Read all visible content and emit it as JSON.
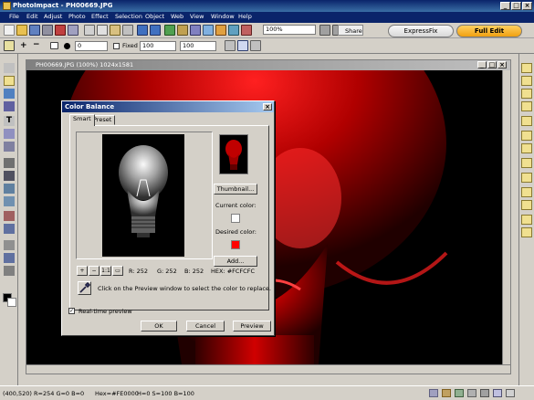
{
  "app": {
    "title": "PhotoImpact - PH00669.JPG",
    "min": "_",
    "max": "□",
    "close": "×"
  },
  "menu": [
    "File",
    "Edit",
    "Adjust",
    "Photo",
    "Effect",
    "Selection",
    "Object",
    "Web",
    "View",
    "Window",
    "Help"
  ],
  "toolbar": {
    "zoom_value": "100%",
    "share_label": "Share",
    "expressfix_label": "ExpressFix",
    "fulledit_label": "Full Edit"
  },
  "attrbar": {
    "angle_value": "0",
    "fixed_label": "Fixed",
    "width_value": "100",
    "height_value": "100"
  },
  "document": {
    "title": "PH00669.JPG (100%) 1024x1581",
    "min": "_",
    "max": "□",
    "close": "×"
  },
  "dialog": {
    "title": "Color Balance",
    "close": "×",
    "tabs": [
      {
        "label": "Smart",
        "active": true
      },
      {
        "label": "Preset",
        "active": false
      }
    ],
    "thumbnail_button": "Thumbnail...",
    "current_color_label": "Current color:",
    "current_color": "#FCFCFC",
    "desired_color_label": "Desired color:",
    "desired_color": "#FE0000",
    "add_button": "Add...",
    "zoom_fit_label": "1:1",
    "readout": {
      "r": "R: 252",
      "g": "G: 252",
      "b": "B: 252",
      "hex": "HEX: #FCFCFC"
    },
    "hint": "Click on the Preview window to select the color to replace.",
    "realtime_label": "Real-time preview",
    "realtime_checked": true,
    "ok": "OK",
    "cancel": "Cancel",
    "preview": "Preview"
  },
  "status": {
    "coords": "(400,520) R=254 G=0 B=0",
    "hex": "Hex=#FE0000",
    "hsb": "H=0 S=100 B=100"
  },
  "colors": {
    "accent_red": "#fe0000",
    "titlebar_blue": "#0a246a",
    "fulledit_orange": "#f5b020"
  }
}
